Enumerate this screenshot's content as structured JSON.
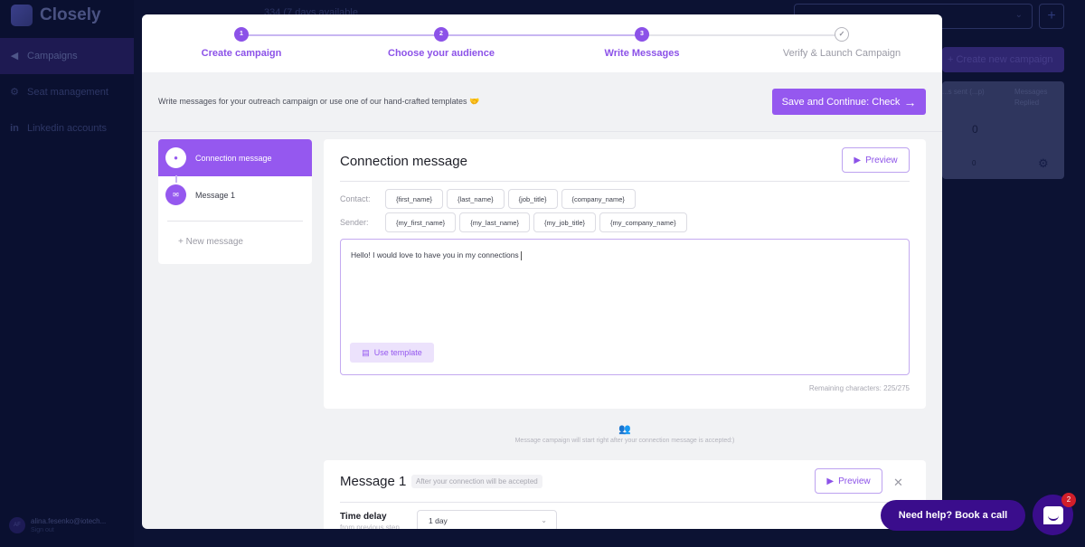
{
  "app": {
    "name": "Closely"
  },
  "sidebar": {
    "items": [
      {
        "label": "Campaigns",
        "icon": "megaphone-icon",
        "active": true
      },
      {
        "label": "Seat management",
        "icon": "gear-icon"
      },
      {
        "label": "Linkedin accounts",
        "icon": "linkedin-icon"
      }
    ],
    "user": {
      "initials": "AF",
      "email": "alina.fesenko@iotech...",
      "sign_out": "Sign out"
    }
  },
  "background": {
    "days_available": "334 (7 days available",
    "create_campaign": "+ Create new campaign",
    "table_headers": [
      "...s sent (...p)",
      "Messages Replied"
    ],
    "table_values": [
      "0",
      "0"
    ]
  },
  "stepper": {
    "steps": [
      {
        "number": "1",
        "label": "Create campaign",
        "state": "active"
      },
      {
        "number": "2",
        "label": "Choose your audience",
        "state": "active"
      },
      {
        "number": "3",
        "label": "Write Messages",
        "state": "current"
      },
      {
        "number": "✓",
        "label": "Verify & Launch Campaign",
        "state": "pending"
      }
    ]
  },
  "infobar": {
    "text": "Write messages for your outreach campaign or use one of our hand-crafted templates 🤝",
    "save_button": "Save and Continue: Check"
  },
  "message_list": {
    "items": [
      {
        "label": "Connection message",
        "icon": "person-icon",
        "active": true
      },
      {
        "label": "Message 1",
        "icon": "envelope-icon",
        "active": false
      }
    ],
    "new_message": "+ New message"
  },
  "connection_message": {
    "title": "Connection message",
    "preview": "Preview",
    "contact_label": "Contact:",
    "contact_tags": [
      "{first_name}",
      "{last_name}",
      "{job_title}",
      "{company_name}"
    ],
    "sender_label": "Sender:",
    "sender_tags": [
      "{my_first_name}",
      "{my_last_name}",
      "{my_job_title}",
      "{my_company_name}"
    ],
    "body": "Hello! I would love to have you in my connections",
    "use_template": "Use template",
    "remaining": "Remaining characters: 225/275"
  },
  "hint": "Message campaign will start right after your connection message is accepted:)",
  "message1": {
    "title": "Message 1",
    "badge": "After your connection will be accepted",
    "preview": "Preview",
    "time_delay_label": "Time delay",
    "time_delay_sub": "from previous step",
    "time_delay_value": "1 day"
  },
  "help": {
    "button": "Need help? Book a call",
    "chat_badge": "2"
  },
  "colors": {
    "accent": "#9558ef",
    "help_bg": "#3a0d8c",
    "sidebar_bg": "#0a1030"
  }
}
